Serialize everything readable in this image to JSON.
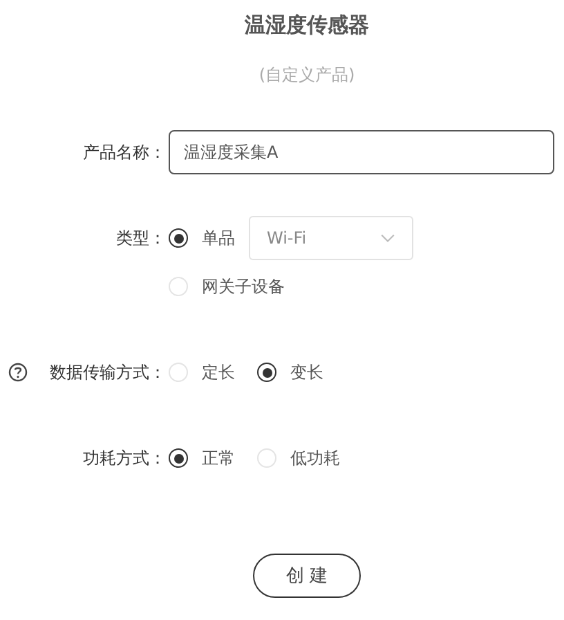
{
  "title": "温湿度传感器",
  "subtitle": "(自定义产品)",
  "fields": [
    {
      "kind": "text",
      "label": "产品名称：",
      "value": "温湿度采集A"
    },
    {
      "kind": "radio",
      "label": "类型：",
      "options": [
        {
          "label": "单品",
          "selected": true,
          "select": {
            "value": "Wi-Fi"
          }
        },
        {
          "label": "网关子设备",
          "selected": false
        }
      ]
    },
    {
      "kind": "radio",
      "label": "数据传输方式：",
      "help": true,
      "options": [
        {
          "label": "定长",
          "selected": false
        },
        {
          "label": "变长",
          "selected": true
        }
      ]
    },
    {
      "kind": "radio",
      "label": "功耗方式：",
      "options": [
        {
          "label": "正常",
          "selected": true
        },
        {
          "label": "低功耗",
          "selected": false
        }
      ]
    }
  ],
  "button": "创 建"
}
